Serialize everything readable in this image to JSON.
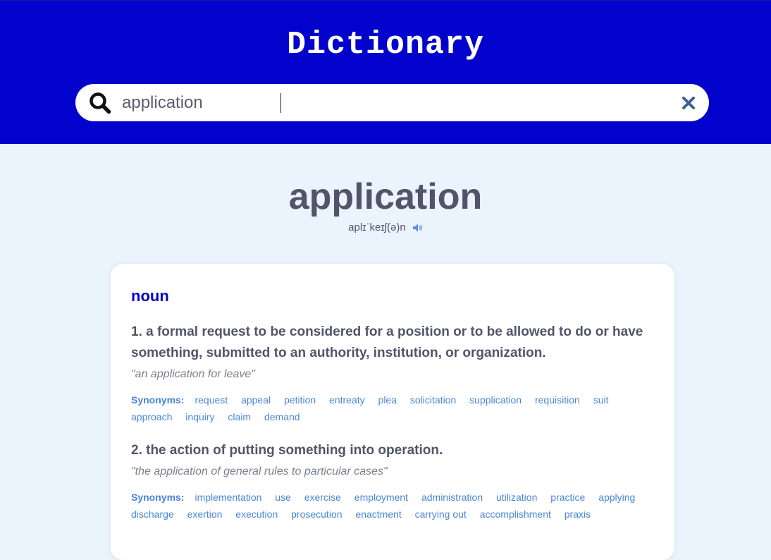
{
  "header": {
    "title": "Dictionary",
    "bg_color": "#0202cc"
  },
  "search": {
    "value": "application",
    "search_icon": "search-icon",
    "clear_icon": "close-icon"
  },
  "entry": {
    "word": "application",
    "phonetic": "aplɪˈkeɪʃ(ə)n",
    "audio_icon": "speaker-icon",
    "part_of_speech": "noun",
    "synonyms_label": "Synonyms:",
    "definitions": [
      {
        "text": "1. a formal request to be considered for a position or to be allowed to do or have something, submitted to an authority, institution, or organization.",
        "example": "\"an application for leave\"",
        "synonyms": [
          "request",
          "appeal",
          "petition",
          "entreaty",
          "plea",
          "solicitation",
          "supplication",
          "requisition",
          "suit",
          "approach",
          "inquiry",
          "claim",
          "demand"
        ]
      },
      {
        "text": "2. the action of putting something into operation.",
        "example": "\"the application of general rules to particular cases\"",
        "synonyms": [
          "implementation",
          "use",
          "exercise",
          "employment",
          "administration",
          "utilization",
          "practice",
          "applying",
          "discharge",
          "exertion",
          "execution",
          "prosecution",
          "enactment",
          "carrying out",
          "accomplishment",
          "praxis"
        ]
      }
    ]
  },
  "colors": {
    "accent": "#0303c6",
    "synonym": "#4a86d8",
    "text": "#50556b",
    "page_bg": "#ebf3fd"
  }
}
